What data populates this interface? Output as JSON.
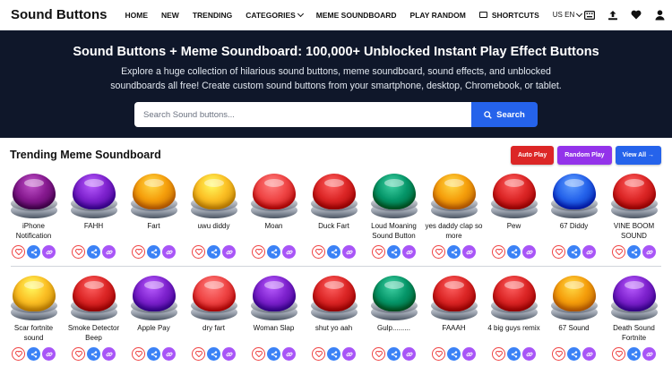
{
  "nav": {
    "logo": "Sound Buttons",
    "links": {
      "home": "HOME",
      "new": "NEW",
      "trending": "TRENDING",
      "categories": "CATEGORIES",
      "meme": "MEME SOUNDBOARD",
      "random": "PLAY RANDOM",
      "shortcuts": "SHORTCUTS"
    },
    "language": "US  EN"
  },
  "hero": {
    "title": "Sound Buttons + Meme Soundboard: 100,000+ Unblocked Instant Play Effect Buttons",
    "description": "Explore a huge collection of hilarious sound buttons, meme soundboard, sound effects, and unblocked soundboards all free! Create custom sound buttons from your smartphone, desktop, Chromebook, or tablet.",
    "search_placeholder": "Search Sound buttons...",
    "search_button": "Search"
  },
  "section": {
    "title": "Trending Meme Soundboard",
    "auto_play": "Auto Play",
    "random_play": "Random Play",
    "view_all": "View All →"
  },
  "colors": {
    "purple": "#7e22ce",
    "orange": "#f59e0b",
    "red": "#dc2626",
    "green": "#059669",
    "blue": "#2563eb",
    "yellow": "#fbbf24"
  },
  "buttons_row1": [
    {
      "label": "iPhone Notification",
      "color": "#86198f"
    },
    {
      "label": "FAHH",
      "color": "#7e22ce"
    },
    {
      "label": "Fart",
      "color": "#f59e0b"
    },
    {
      "label": "uwu diddy",
      "color": "#fbbf24"
    },
    {
      "label": "Moan",
      "color": "#ef4444"
    },
    {
      "label": "Duck Fart",
      "color": "#dc2626"
    },
    {
      "label": "Loud Moaning Sound Button",
      "color": "#059669"
    },
    {
      "label": "yes daddy clap so more",
      "color": "#f59e0b"
    },
    {
      "label": "Pew",
      "color": "#dc2626"
    },
    {
      "label": "67 Diddy",
      "color": "#2563eb"
    },
    {
      "label": "VINE BOOM SOUND",
      "color": "#dc2626"
    }
  ],
  "buttons_row2": [
    {
      "label": "Scar fortnite sound",
      "color": "#fbbf24"
    },
    {
      "label": "Smoke Detector Beep",
      "color": "#dc2626"
    },
    {
      "label": "Apple Pay",
      "color": "#7e22ce"
    },
    {
      "label": "dry fart",
      "color": "#ef4444"
    },
    {
      "label": "Woman Slap",
      "color": "#7e22ce"
    },
    {
      "label": "shut yo aah",
      "color": "#dc2626"
    },
    {
      "label": "Gulp.........",
      "color": "#059669"
    },
    {
      "label": "FAAAH",
      "color": "#dc2626"
    },
    {
      "label": "4 big guys remix",
      "color": "#dc2626"
    },
    {
      "label": "67 Sound",
      "color": "#f59e0b"
    },
    {
      "label": "Death Sound Fortnite",
      "color": "#7e22ce"
    }
  ]
}
